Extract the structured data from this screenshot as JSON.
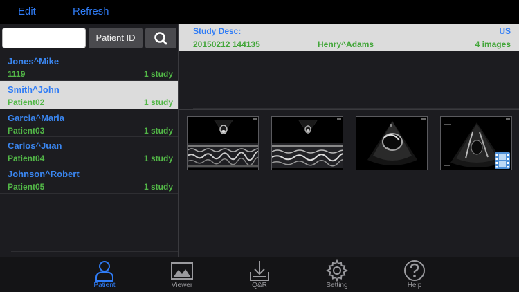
{
  "topbar": {
    "edit_label": "Edit",
    "refresh_label": "Refresh"
  },
  "search": {
    "value": "",
    "placeholder": "",
    "patient_id_label": "Patient ID"
  },
  "patients": [
    {
      "name": "Jones^Mike",
      "id": "1119",
      "count": "1 study",
      "selected": false
    },
    {
      "name": "Smith^John",
      "id": "Patient02",
      "count": "1 study",
      "selected": true
    },
    {
      "name": "Garcia^Maria",
      "id": "Patient03",
      "count": "1 study",
      "selected": false
    },
    {
      "name": "Carlos^Juan",
      "id": "Patient04",
      "count": "1 study",
      "selected": false
    },
    {
      "name": "Johnson^Robert",
      "id": "Patient05",
      "count": "1 study",
      "selected": false
    }
  ],
  "study": {
    "desc_label": "Study Desc:",
    "modality": "US",
    "datetime": "20150212 144135",
    "patient_name": "Henry^Adams",
    "image_count": "4 images"
  },
  "thumbnails": [
    {
      "kind": "m-mode"
    },
    {
      "kind": "m-mode"
    },
    {
      "kind": "sector"
    },
    {
      "kind": "sector-video"
    }
  ],
  "tabs": [
    {
      "label": "Patient",
      "icon": "person-icon",
      "active": true
    },
    {
      "label": "Viewer",
      "icon": "image-icon",
      "active": false
    },
    {
      "label": "Q&R",
      "icon": "download-tray-icon",
      "active": false
    },
    {
      "label": "Setting",
      "icon": "gear-icon",
      "active": false
    },
    {
      "label": "Help",
      "icon": "help-icon",
      "active": false
    }
  ],
  "colors": {
    "accent": "#2f7cf6",
    "green": "#52b747",
    "selected_row": "#dcdcdc"
  }
}
